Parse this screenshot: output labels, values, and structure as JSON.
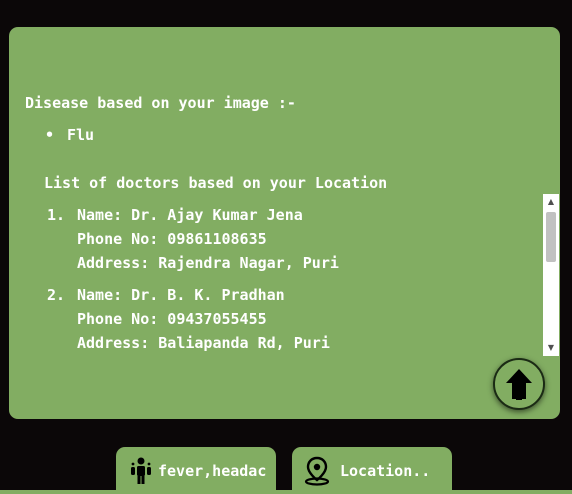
{
  "result": {
    "disease_heading": "Disease based on your image :-",
    "diseases": [
      "Flu"
    ],
    "doctors_heading": "List of doctors based on your Location",
    "doctors": [
      {
        "number": "1.",
        "name": "Name: Dr. Ajay Kumar Jena",
        "phone": "Phone No: 09861108635",
        "address": "Address: Rajendra Nagar, Puri"
      },
      {
        "number": "2.",
        "name": "Name: Dr. B. K. Pradhan",
        "phone": "Phone No: 09437055455",
        "address": "Address: Baliapanda Rd, Puri"
      }
    ]
  },
  "controls": {
    "scroll_top_icon": "arrow-up-icon",
    "symptoms_icon": "person-symptoms-icon",
    "symptoms_value": "fever,headache",
    "location_icon": "map-pin-icon",
    "location_label": "Location.."
  },
  "colors": {
    "background": "#0b0708",
    "card": "#82ad62",
    "text": "#ffffff"
  }
}
